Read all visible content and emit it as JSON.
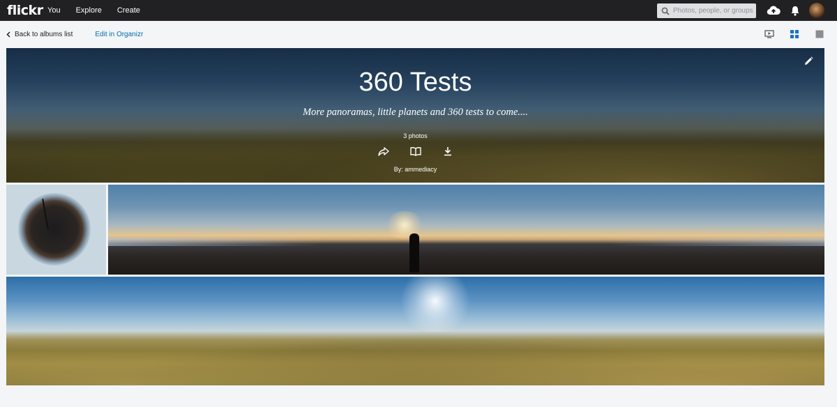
{
  "topnav": {
    "logo": "flickr",
    "links": [
      "You",
      "Explore",
      "Create"
    ],
    "search_placeholder": "Photos, people, or groups",
    "icons": [
      "search-icon",
      "upload-cloud-icon",
      "notification-bell-icon",
      "avatar"
    ]
  },
  "subnav": {
    "back_label": "Back to albums list",
    "organizr_label": "Edit in Organizr",
    "view_icons": [
      "slideshow-icon",
      "grid-view-icon",
      "single-view-icon"
    ]
  },
  "album": {
    "title": "360 Tests",
    "description": "More panoramas, little planets and 360 tests to come....",
    "photo_count": "3 photos",
    "byline": "By: ammediacy",
    "actions": [
      "share-icon",
      "book-icon",
      "download-icon"
    ]
  },
  "colors": {
    "nav_bg": "#212124",
    "link_blue": "#006dac",
    "page_bg": "#f3f5f6",
    "active_view": "#1a73c8"
  }
}
